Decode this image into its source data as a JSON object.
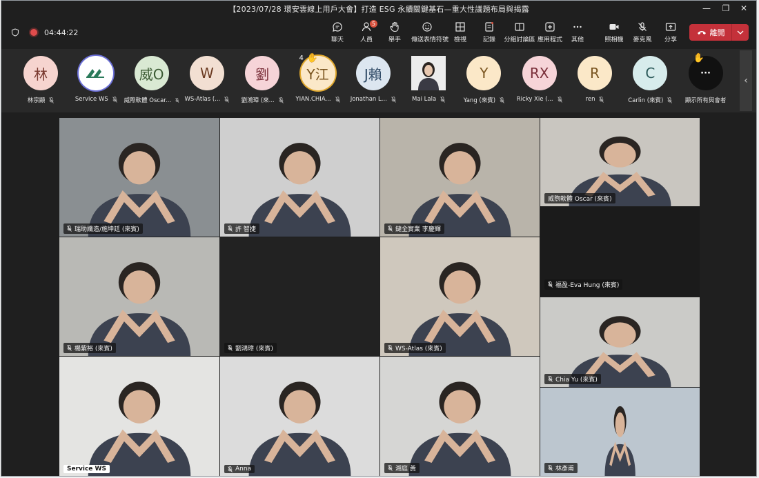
{
  "window": {
    "title": "【2023/07/28 環安雲線上用戶大會】打造 ESG 永續關鍵基石—重大性議題布局與揭露"
  },
  "toolbar": {
    "timer": "04:44:22",
    "buttons": [
      {
        "label": "聊天",
        "icon": "chat-icon"
      },
      {
        "label": "人員",
        "icon": "people-icon",
        "badge": "5"
      },
      {
        "label": "舉手",
        "icon": "raise-hand-icon"
      },
      {
        "label": "傳送表情符號",
        "icon": "emoji-icon"
      },
      {
        "label": "檢視",
        "icon": "grid-view-icon"
      },
      {
        "label": "記錄",
        "icon": "notes-icon"
      },
      {
        "label": "分組討論區",
        "icon": "breakout-icon"
      },
      {
        "label": "應用程式",
        "icon": "apps-icon"
      },
      {
        "label": "其他",
        "icon": "more-icon"
      },
      {
        "label": "照相機",
        "icon": "camera-icon"
      },
      {
        "label": "麥克風",
        "icon": "mic-off-icon"
      },
      {
        "label": "分享",
        "icon": "share-icon"
      }
    ],
    "leave_label": "離開"
  },
  "participants": [
    {
      "initials": "林",
      "name": "林宗顯",
      "bg": "#f6d4cf",
      "fg": "#7a3a30"
    },
    {
      "initials": "",
      "name": "Service WS",
      "bg": "#ffffff",
      "fg": "#2a7a5a",
      "logo": true
    },
    {
      "initials": "威O",
      "name": "威煦軟體 Oscar...",
      "bg": "#d9e9d3",
      "fg": "#3b5a33"
    },
    {
      "initials": "W",
      "name": "WS-Atlas (...",
      "bg": "#f2dfd2",
      "fg": "#6b3b22"
    },
    {
      "initials": "劉",
      "name": "劉鴻璋 (來...",
      "bg": "#f6d4d8",
      "fg": "#7a2f3a"
    },
    {
      "initials": "Y江",
      "name": "YIAN.CHIA...",
      "bg": "#fbe8c8",
      "fg": "#7a5520",
      "hand": true,
      "ring": true,
      "count": "4"
    },
    {
      "initials": "J賴",
      "name": "Jonathan L...",
      "bg": "#dce6f0",
      "fg": "#2f4a66"
    },
    {
      "initials": "",
      "name": "Mai Lala",
      "bg": "#e8e8e8",
      "fg": "#333",
      "photo": true
    },
    {
      "initials": "Y",
      "name": "Yang (來賓)",
      "bg": "#fbe8c8",
      "fg": "#7a5520"
    },
    {
      "initials": "RX",
      "name": "Ricky Xie (...",
      "bg": "#f6d4d8",
      "fg": "#7a2f3a"
    },
    {
      "initials": "R",
      "name": "ren",
      "bg": "#fbe8c8",
      "fg": "#7a5520"
    },
    {
      "initials": "C",
      "name": "Carlin (來賓)",
      "bg": "#d7ecec",
      "fg": "#2c5a5a"
    },
    {
      "initials": "···",
      "name": "顯示所有與會者",
      "bg": "#111111",
      "fg": "#ffffff",
      "more": true,
      "hand": true
    }
  ],
  "tiles": [
    {
      "name": "瑞助纖造/施坤廷 (來賓)",
      "bg": "#8a8f92",
      "muted": true
    },
    {
      "name": "許 智捷",
      "bg": "#cfcfcf",
      "muted": true
    },
    {
      "name": "鐽全實業 李慶輝",
      "bg": "#b9b4aa",
      "muted": true
    },
    {
      "name": "威煦軟體 Oscar (來賓)",
      "bg": "#c9c6c0",
      "muted": false
    },
    {
      "name": "福盈-Eva Hung (來賓)",
      "bg": "#1b1b1b",
      "muted": true
    },
    {
      "name": "楊紫裕 (來賓)",
      "bg": "#b9b9b5",
      "muted": true
    },
    {
      "name": "劉鴻璋 (來賓)",
      "bg": "#222222",
      "muted": true
    },
    {
      "name": "WS-Atlas (來賓)",
      "bg": "#cfc8bd",
      "muted": true
    },
    {
      "name": "Chia Yu (來賓)",
      "bg": "#cbcbc8",
      "muted": true
    },
    {
      "name": "Service WS",
      "bg": "#e4e4e2",
      "muted": false,
      "plain": true
    },
    {
      "name": "Anna",
      "bg": "#dcdcdc",
      "muted": true
    },
    {
      "name": "湘庭 黃",
      "bg": "#d6d6d4",
      "muted": true
    },
    {
      "name": "林彥甫",
      "bg": "#bcc6cf",
      "muted": true
    }
  ]
}
